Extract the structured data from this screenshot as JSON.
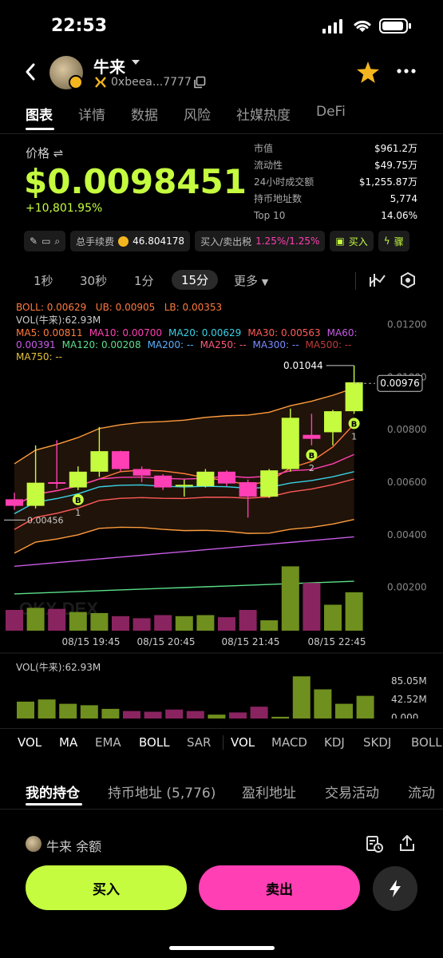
{
  "status": {
    "time": "22:53"
  },
  "header": {
    "token": "牛来",
    "address": "0xbeea...7777"
  },
  "tabs": [
    "图表",
    "详情",
    "数据",
    "风险",
    "社媒热度",
    "DeFi"
  ],
  "price": {
    "label": "价格",
    "value": "$0.0098451",
    "change": "+10,801.95%"
  },
  "stats": [
    {
      "k": "市值",
      "v": "$961.2万"
    },
    {
      "k": "流动性",
      "v": "$49.75万"
    },
    {
      "k": "24小时成交额",
      "v": "$1,255.87万"
    },
    {
      "k": "持币地址数",
      "v": "5,774"
    },
    {
      "k": "Top 10",
      "v": "14.06%"
    }
  ],
  "toolbar": {
    "fee_label": "总手续费",
    "fee_value": "46.804178",
    "tax_label": "买入/卖出税",
    "tax_value": "1.25%/1.25%",
    "buy_chip": "买入",
    "next_chip": "骤"
  },
  "timeframes": [
    "1秒",
    "30秒",
    "1分",
    "15分",
    "更多"
  ],
  "indicators": {
    "boll": {
      "label": "BOLL: 0.00629",
      "ub": "UB: 0.00905",
      "lb": "LB: 0.00353"
    },
    "vol": "VOL(牛来):62.93M",
    "ma_line1": [
      {
        "t": "MA5: 0.00811",
        "c": "#ff7a3d"
      },
      {
        "t": "MA10: 0.00700",
        "c": "#ff3fb3"
      },
      {
        "t": "MA20: 0.00629",
        "c": "#3ad0e6"
      },
      {
        "t": "MA30: 0.00563",
        "c": "#ff5a5a"
      },
      {
        "t": "MA60:",
        "c": "#c85ce6"
      }
    ],
    "ma_line2": [
      {
        "t": "0.00391",
        "c": "#c85ce6"
      },
      {
        "t": "MA120: 0.00208",
        "c": "#5be08a"
      },
      {
        "t": "MA200: --",
        "c": "#5ab0ff"
      },
      {
        "t": "MA250: --",
        "c": "#ff5a7a"
      },
      {
        "t": "MA300: --",
        "c": "#7a8cff"
      },
      {
        "t": "MA500: --",
        "c": "#c03a3a"
      }
    ],
    "ma_line3": [
      {
        "t": "MA750: --",
        "c": "#e6c23a"
      }
    ]
  },
  "chart_data": {
    "type": "candlestick",
    "ylim": [
      0.0012,
      0.0125
    ],
    "y_ticks": [
      "0.01200",
      "0.01000",
      "0.00800",
      "0.00600",
      "0.00400",
      "0.00200"
    ],
    "x_labels": [
      "08/15 19:45",
      "08/15 20:45",
      "08/15 21:45",
      "08/15 22:45"
    ],
    "current_price_label": "0.00976",
    "current_price": 0.00976,
    "high_label": "0.01044",
    "high_value": 0.01044,
    "low_label": "0.00456",
    "low_value": 0.00456,
    "candles": [
      {
        "o": 0.00535,
        "c": 0.0051,
        "h": 0.0056,
        "l": 0.00495,
        "v": 0.2
      },
      {
        "o": 0.0051,
        "c": 0.00598,
        "h": 0.0074,
        "l": 0.005,
        "v": 0.22
      },
      {
        "o": 0.006,
        "c": 0.00595,
        "h": 0.0076,
        "l": 0.00575,
        "v": 0.21
      },
      {
        "o": 0.0058,
        "c": 0.0064,
        "h": 0.0066,
        "l": 0.0057,
        "v": 0.18
      },
      {
        "o": 0.0064,
        "c": 0.00718,
        "h": 0.0081,
        "l": 0.0062,
        "v": 0.17
      },
      {
        "o": 0.00718,
        "c": 0.0065,
        "h": 0.0072,
        "l": 0.0064,
        "v": 0.14
      },
      {
        "o": 0.0065,
        "c": 0.00625,
        "h": 0.0066,
        "l": 0.006,
        "v": 0.12
      },
      {
        "o": 0.00625,
        "c": 0.0058,
        "h": 0.0063,
        "l": 0.0057,
        "v": 0.15
      },
      {
        "o": 0.00585,
        "c": 0.0059,
        "h": 0.0061,
        "l": 0.00545,
        "v": 0.14
      },
      {
        "o": 0.00585,
        "c": 0.0064,
        "h": 0.0065,
        "l": 0.0058,
        "v": 0.15
      },
      {
        "o": 0.0064,
        "c": 0.00595,
        "h": 0.00645,
        "l": 0.00585,
        "v": 0.13
      },
      {
        "o": 0.006,
        "c": 0.00545,
        "h": 0.0061,
        "l": 0.00465,
        "v": 0.2
      },
      {
        "o": 0.00545,
        "c": 0.00645,
        "h": 0.0065,
        "l": 0.0054,
        "v": 0.1
      },
      {
        "o": 0.0065,
        "c": 0.00845,
        "h": 0.0088,
        "l": 0.0064,
        "v": 0.62
      },
      {
        "o": 0.0078,
        "c": 0.00765,
        "h": 0.0086,
        "l": 0.0074,
        "v": 0.46
      },
      {
        "o": 0.0079,
        "c": 0.0087,
        "h": 0.00875,
        "l": 0.0074,
        "v": 0.25
      },
      {
        "o": 0.0087,
        "c": 0.0098,
        "h": 0.01044,
        "l": 0.0086,
        "v": 0.37
      }
    ],
    "buy_markers": [
      {
        "i": 3,
        "label": "1"
      },
      {
        "i": 14,
        "label": "2"
      },
      {
        "i": 16,
        "label": "1"
      }
    ],
    "vol_panel": {
      "label": "VOL(牛来):62.93M",
      "y_ticks": [
        "85.05M",
        "42.52M",
        "0.000"
      ],
      "values": [
        0.3,
        0.33,
        0.27,
        0.25,
        0.2,
        0.17,
        0.16,
        0.19,
        0.17,
        0.12,
        0.15,
        0.23,
        0.09,
        0.65,
        0.47,
        0.27,
        0.38
      ],
      "up": [
        true,
        true,
        true,
        true,
        true,
        false,
        false,
        false,
        false,
        true,
        false,
        false,
        true,
        true,
        true,
        true,
        true
      ]
    }
  },
  "bottom_tabs": [
    "VOL",
    "MA",
    "EMA",
    "BOLL",
    "SAR",
    "VOL",
    "MACD",
    "KDJ",
    "SKDJ",
    "BOLL"
  ],
  "position_tabs": [
    "我的持仓",
    "持币地址 (5,776)",
    "盈利地址",
    "交易活动",
    "流动"
  ],
  "balance": {
    "token": "牛来",
    "label": "余额"
  },
  "actions": {
    "buy": "买入",
    "sell": "卖出"
  },
  "colors": {
    "up": "#c5fc3f",
    "down": "#ff3fb3",
    "accent": "#f3b61f"
  }
}
